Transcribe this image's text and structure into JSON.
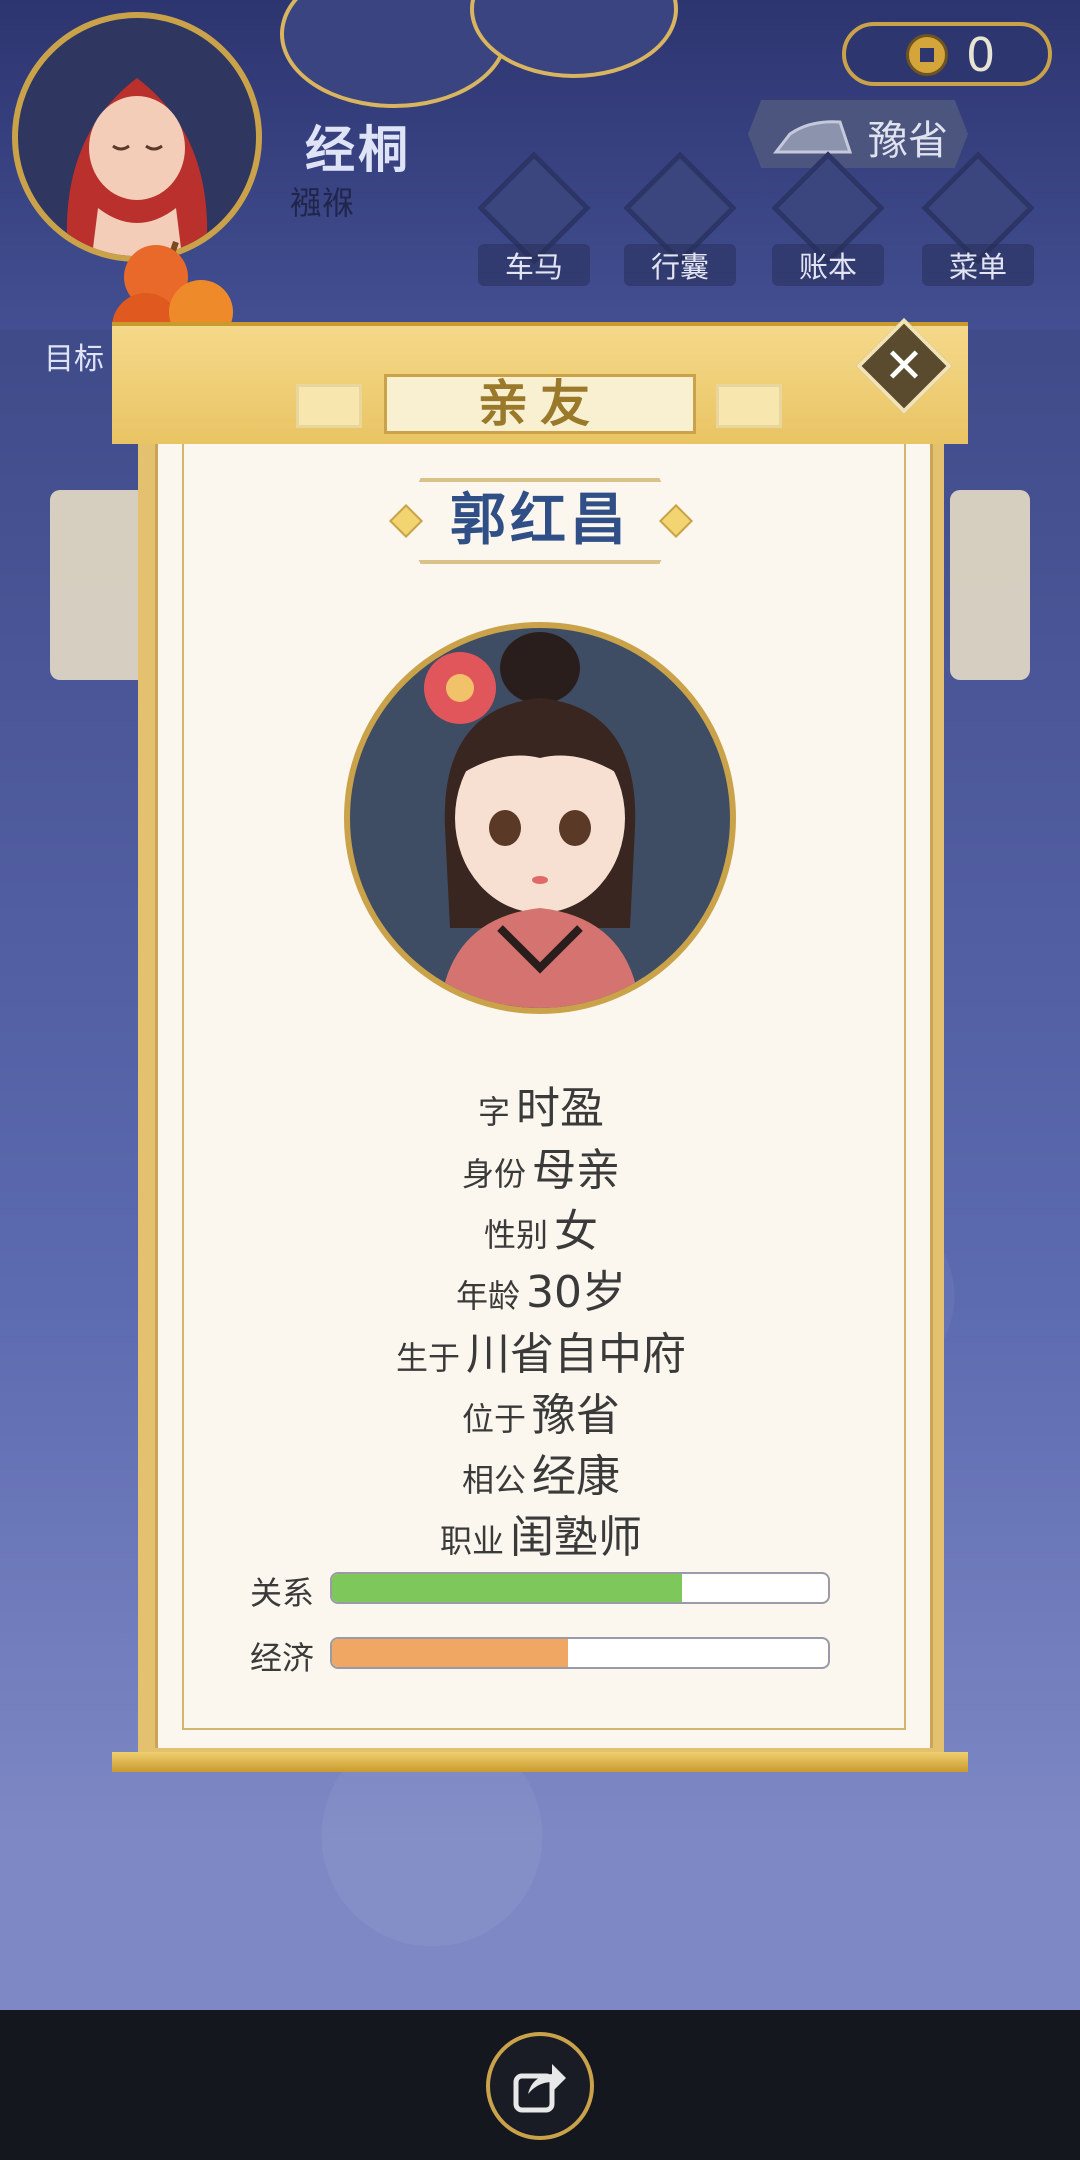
{
  "header": {
    "player_name": "经桐",
    "player_age": "襁褓",
    "coins": "0",
    "location": "豫省"
  },
  "nav": [
    {
      "label": "车马",
      "icon": "carriage-icon"
    },
    {
      "label": "行囊",
      "icon": "bag-icon"
    },
    {
      "label": "账本",
      "icon": "ledger-icon"
    },
    {
      "label": "菜单",
      "icon": "menu-icon"
    }
  ],
  "goal_label": "目标",
  "dialog": {
    "title": "亲友",
    "person_name": "郭红昌",
    "fields": [
      {
        "label": "字",
        "value": "时盈"
      },
      {
        "label": "身份",
        "value": "母亲"
      },
      {
        "label": "性别",
        "value": "女"
      },
      {
        "label": "年龄",
        "value": "30岁"
      },
      {
        "label": "生于",
        "value": "川省自中府"
      },
      {
        "label": "位于",
        "value": "豫省"
      },
      {
        "label": "相公",
        "value": "经康"
      },
      {
        "label": "职业",
        "value": "闺塾师"
      }
    ],
    "bars": [
      {
        "label": "关系",
        "value": 0.705,
        "color": "#7ec75a"
      },
      {
        "label": "经济",
        "value": 0.475,
        "color": "#f0a764"
      }
    ]
  },
  "colors": {
    "gold": "#c9a24a",
    "paper": "#fbf7ee",
    "name_blue": "#2f4f86",
    "bottom_bar": "#15171f"
  }
}
